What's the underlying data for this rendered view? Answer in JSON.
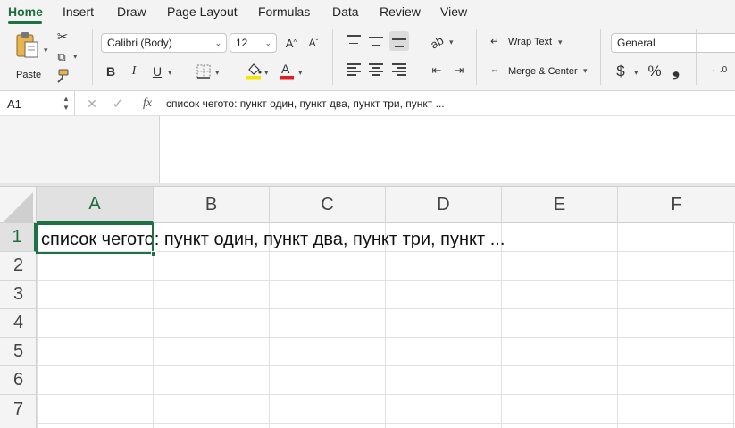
{
  "tabs": [
    "Home",
    "Insert",
    "Draw",
    "Page Layout",
    "Formulas",
    "Data",
    "Review",
    "View"
  ],
  "ribbon": {
    "paste_label": "Paste",
    "font_name": "Calibri (Body)",
    "font_size": "12",
    "bold": "B",
    "italic": "I",
    "underline": "U",
    "wrap_text": "Wrap Text",
    "merge_center": "Merge & Center",
    "number_format": "General",
    "currency_symbol": "$",
    "percent_symbol": "%",
    "comma_symbol": "❟",
    "font_color_hex": "#e02020",
    "highlight_color_hex": "#f5e400"
  },
  "formula_bar": {
    "name_box": "A1",
    "cancel_symbol": "✕",
    "enter_symbol": "✓",
    "fx_label": "fx",
    "content": "список чегото: пункт один, пункт два, пункт три, пункт ..."
  },
  "grid": {
    "columns": [
      "A",
      "B",
      "C",
      "D",
      "E",
      "F"
    ],
    "rows": [
      "1",
      "2",
      "3",
      "4",
      "5",
      "6",
      "7"
    ],
    "selected_cell": "A1",
    "cell_a1": "список чегото: пункт один, пункт два, пункт три, пункт ..."
  },
  "accent_color": "#1e7145"
}
